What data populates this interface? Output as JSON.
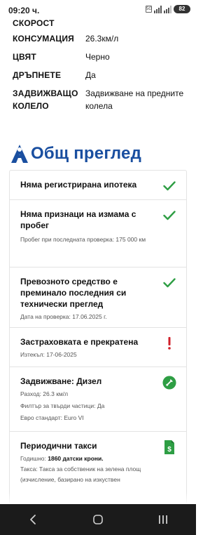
{
  "status_bar": {
    "time": "09:20 ч.",
    "sim": "5G",
    "battery": "82"
  },
  "specs": [
    {
      "label": "СКОРОСТ",
      "value": ""
    },
    {
      "label": "КОНСУМАЦИЯ",
      "value": "26.3км/л"
    },
    {
      "label": "ЦВЯТ",
      "value": "Черно"
    },
    {
      "label": "ДРЪПНЕТЕ",
      "value": "Да"
    },
    {
      "label": "ЗАДВИЖВАЩО КОЛЕЛО",
      "value": "Задвижване на предните колела"
    }
  ],
  "overview": {
    "title": "Общ преглед",
    "logo_icon": "brand-logo-icon",
    "brand_color": "#1a4fa0"
  },
  "cards": [
    {
      "title": "Няма регистрирана ипотека",
      "lines": [],
      "icon": "check-icon"
    },
    {
      "title": "Няма признаци на измама с пробег",
      "lines": [
        "Пробег при последната проверка: 175 000 км"
      ],
      "icon": "check-icon"
    },
    {
      "title": "Превозното средство е преминало последния си технически преглед",
      "lines": [
        "Дата на проверка: 17.06.2025 г."
      ],
      "icon": "check-icon"
    },
    {
      "title": "Застраховката е прекратена",
      "lines": [
        "Изтекъл: 17-06-2025"
      ],
      "icon": "exclamation-icon"
    },
    {
      "title": "Задвижване: Дизел",
      "lines": [
        "Разход: 26.3 км/л",
        "Филтър за твърди частици: Да",
        "Евро стандарт: Euro VI"
      ],
      "icon": "fuel-icon"
    },
    {
      "title": "Периодични такси",
      "line_bold_prefix": "Годишно: ",
      "line_bold": "1860 датски крони.",
      "lines": [
        "Такса: Такса за собственик на зелена площ",
        "(изчисление, базирано на изкуствен"
      ],
      "icon": "dollar-document-icon"
    }
  ],
  "colors": {
    "check": "#2e9e44",
    "warning": "#d0202a",
    "fuel": "#2e9e44",
    "navbar": "#1b1b1b"
  },
  "navbar": {
    "back_icon": "back-icon",
    "home_icon": "home-icon",
    "recents_icon": "recents-icon"
  }
}
